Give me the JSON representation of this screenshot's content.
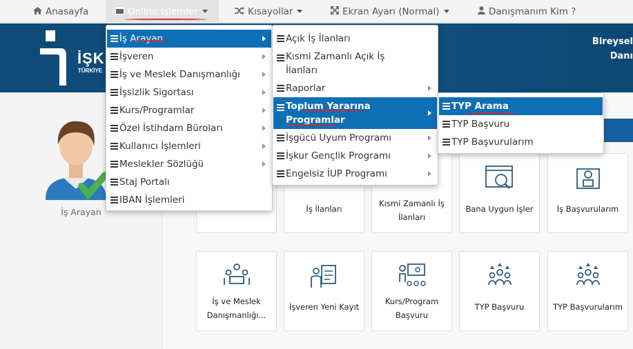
{
  "topnav": {
    "home": "Anasayfa",
    "online": "Online İşlemler",
    "shortcuts": "Kısayollar",
    "screen": "Ekran Ayarı (Normal)",
    "advisor": "Danışmanım Kim ?"
  },
  "header": {
    "logo_text": "İŞK",
    "logo_sub": "TÜRKİYE",
    "right_line1": "Bireysel",
    "right_line2": "Danı"
  },
  "profile": {
    "role": "İş Arayan"
  },
  "menu1": [
    {
      "label": "İş Arayan",
      "sub": true
    },
    {
      "label": "İşveren",
      "sub": true
    },
    {
      "label": "İş ve Meslek Danışmanlığı",
      "sub": true
    },
    {
      "label": "İşsizlik Sigortası",
      "sub": true
    },
    {
      "label": "Kurs/Programlar",
      "sub": true
    },
    {
      "label": "Özel İstihdam Büroları",
      "sub": true
    },
    {
      "label": "Kullanıcı İşlemleri",
      "sub": true
    },
    {
      "label": "Meslekler Sözlüğü",
      "sub": true
    },
    {
      "label": "Staj Portalı",
      "sub": false
    },
    {
      "label": "IBAN İşlemleri",
      "sub": false
    }
  ],
  "menu2": [
    {
      "label": "Açık İş İlanları"
    },
    {
      "label": "Kısmi Zamanlı Açık İş İlanları"
    },
    {
      "label": "Raporlar"
    },
    {
      "label": "Toplum Yararına Programlar"
    },
    {
      "label": "İşgücü Uyum Programı"
    },
    {
      "label": "İşkur Gençlik Programı"
    },
    {
      "label": "Engelsiz İUP Programı"
    }
  ],
  "menu3": [
    {
      "label": "TYP Arama"
    },
    {
      "label": "TYP Başvuru"
    },
    {
      "label": "TYP Başvurularım"
    }
  ],
  "cards_row1": [
    {
      "label": "İş İlanları",
      "icon": "laptop-icon"
    },
    {
      "label": "Kısmi Zamanlı İş İlanları",
      "icon": "search-people-icon"
    },
    {
      "label": "Bana Uygun İşler",
      "icon": "browser-search-icon"
    },
    {
      "label": "İş Başvurularım",
      "icon": "profile-briefcase-icon"
    }
  ],
  "cards_row2": [
    {
      "label": "İş ve Meslek Danışmanlığı...",
      "icon": "meeting-icon"
    },
    {
      "label": "İşveren Yeni Kayıt",
      "icon": "clipboard-person-icon"
    },
    {
      "label": "Kurs/Program Başvuru",
      "icon": "presentation-icon"
    },
    {
      "label": "TYP Başvuru",
      "icon": "group-up-icon"
    },
    {
      "label": "TYP Başvurularım",
      "icon": "group-up-icon"
    }
  ],
  "colors": {
    "brand_blue": "#0f4c7a",
    "menu_selected": "#0f6fb5",
    "annotation": "#d9262c"
  }
}
